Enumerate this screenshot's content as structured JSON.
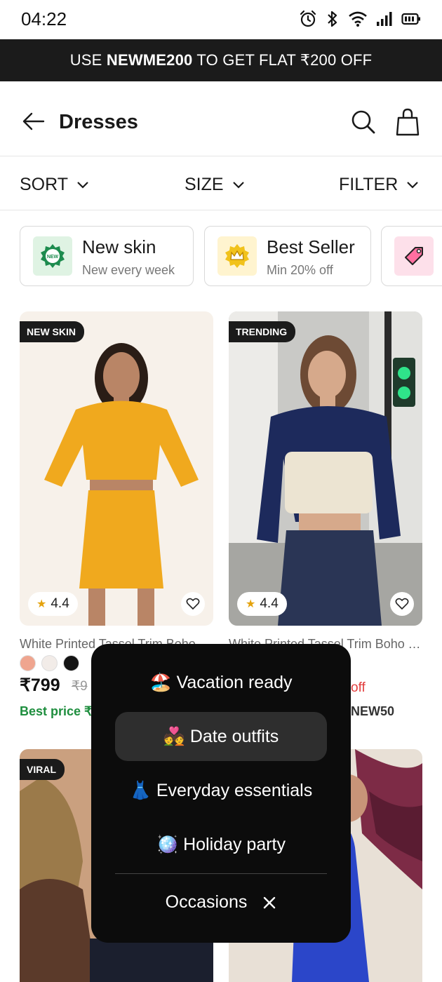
{
  "status_bar": {
    "time": "04:22",
    "icons": [
      "alarm-icon",
      "bluetooth-icon",
      "wifi-icon",
      "signal-icon",
      "battery-icon"
    ]
  },
  "promo": {
    "prefix": "USE ",
    "code": "NEWME200",
    "suffix": " TO GET FLAT ₹200 OFF"
  },
  "header": {
    "title": "Dresses",
    "icons": [
      "back-arrow-icon",
      "search-icon",
      "shopping-bag-icon"
    ]
  },
  "sort_bar": {
    "sort": "SORT",
    "size": "SIZE",
    "filter": "FILTER"
  },
  "chips": [
    {
      "title": "New skin",
      "subtitle": "New every week",
      "icon": "new-badge-icon",
      "icon_bg": "#dff3e3"
    },
    {
      "title": "Best Seller",
      "subtitle": "Min 20% off",
      "icon": "crown-icon",
      "icon_bg": "#fff4cf"
    },
    {
      "title": "",
      "subtitle": "",
      "icon": "price-tag-icon",
      "icon_bg": "#fde0ea"
    }
  ],
  "products": [
    {
      "badge": "NEW SKIN",
      "rating": "4.4",
      "name": "White Printed Tassel Trim Boho T...",
      "swatches": [
        "#efa58f",
        "#f2ece8",
        "#141414"
      ],
      "price": "₹799",
      "old_price": "₹9",
      "best_price": "Best price ₹"
    },
    {
      "badge": "TRENDING",
      "rating": "4.4",
      "name": "White Printed Tassel Trim Boho T...",
      "off_text": "off",
      "code_text": "NEW50"
    },
    {
      "badge": "VIRAL"
    },
    {
      "badge": ""
    }
  ],
  "occasions_popup": {
    "items": [
      {
        "emoji": "🏖️",
        "label": "Vacation ready"
      },
      {
        "emoji": "💑",
        "label": "Date outfits",
        "selected": true
      },
      {
        "emoji": "👗",
        "label": "Everyday essentials"
      },
      {
        "emoji": "🪩",
        "label": "Holiday party"
      }
    ],
    "footer_label": "Occasions",
    "close_icon": "close-icon"
  },
  "colors": {
    "promo_bg": "#1b1b1b",
    "popup_bg": "#0c0c0c",
    "popup_selected_bg": "#2e2e2e",
    "best_price_green": "#1e8e3e",
    "badge_bg": "#1b1b1b",
    "star": "#e4a20d"
  }
}
